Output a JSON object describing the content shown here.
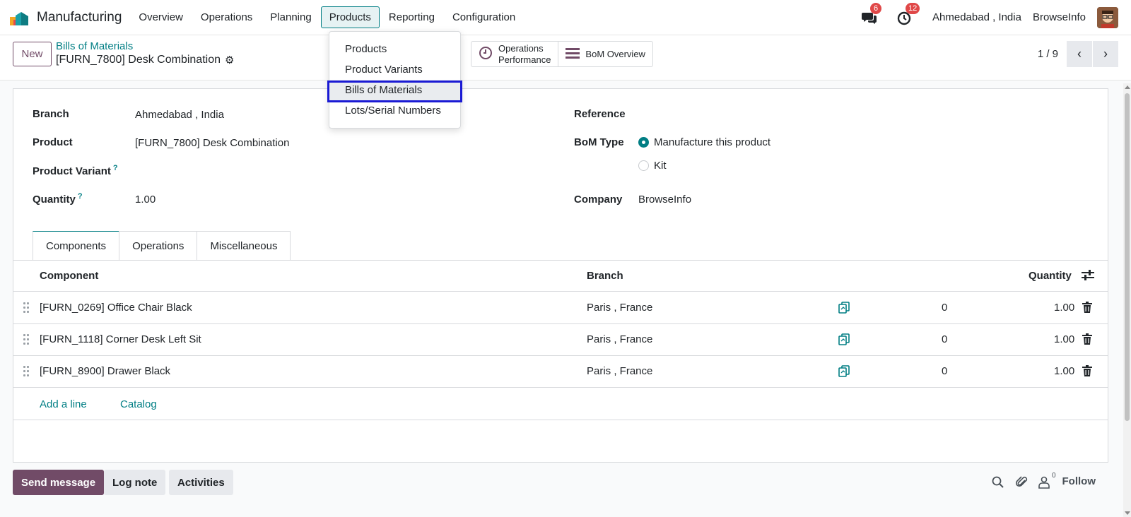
{
  "navbar": {
    "app_title": "Manufacturing",
    "menu": [
      "Overview",
      "Operations",
      "Planning",
      "Products",
      "Reporting",
      "Configuration"
    ],
    "active_menu": "Products",
    "messages_badge": "6",
    "activities_badge": "12",
    "branch": "Ahmedabad , India",
    "company": "BrowseInfo"
  },
  "control": {
    "new_label": "New",
    "breadcrumb": "Bills of Materials",
    "record_title": "[FURN_7800] Desk Combination",
    "smart_buttons": {
      "operations_performance_line1": "Operations",
      "operations_performance_line2": "Performance",
      "bom_overview": "BoM Overview"
    },
    "pager": "1 / 9"
  },
  "dropdown": {
    "items": [
      "Products",
      "Product Variants",
      "Bills of Materials",
      "Lots/Serial Numbers"
    ],
    "highlighted": "Bills of Materials"
  },
  "form": {
    "branch_label": "Branch",
    "branch_value": "Ahmedabad , India",
    "product_label": "Product",
    "product_value": "[FURN_7800] Desk Combination",
    "variant_label": "Product Variant",
    "quantity_label": "Quantity",
    "quantity_value": "1.00",
    "help_mark": "?",
    "reference_label": "Reference",
    "bom_type_label": "BoM Type",
    "bom_type_options": [
      "Manufacture this product",
      "Kit"
    ],
    "bom_type_selected": "Manufacture this product",
    "company_label": "Company",
    "company_value": "BrowseInfo"
  },
  "tabs": [
    "Components",
    "Operations",
    "Miscellaneous"
  ],
  "active_tab": "Components",
  "components": {
    "headers": {
      "component": "Component",
      "branch": "Branch",
      "quantity": "Quantity"
    },
    "rows": [
      {
        "component": "[FURN_0269] Office Chair Black",
        "branch": "Paris , France",
        "count": "0",
        "quantity": "1.00"
      },
      {
        "component": "[FURN_1118] Corner Desk Left Sit",
        "branch": "Paris , France",
        "count": "0",
        "quantity": "1.00"
      },
      {
        "component": "[FURN_8900] Drawer Black",
        "branch": "Paris , France",
        "count": "0",
        "quantity": "1.00"
      }
    ],
    "add_line": "Add a line",
    "catalog": "Catalog"
  },
  "chatter": {
    "send_message": "Send message",
    "log_note": "Log note",
    "activities": "Activities",
    "followers_count": "0",
    "follow": "Follow"
  },
  "colors": {
    "brand": "#714b67",
    "accent": "#017e84",
    "badge": "#e04848",
    "highlight_border": "#1a1ad4"
  }
}
